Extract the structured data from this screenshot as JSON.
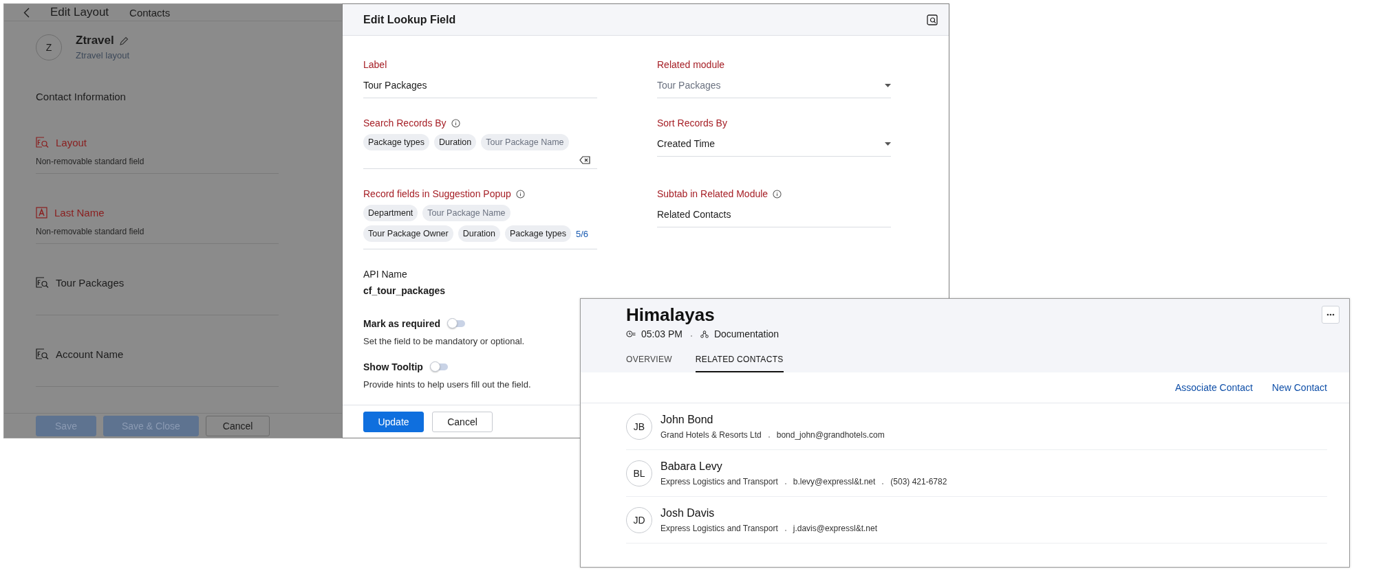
{
  "background_window": {
    "title": "Edit Layout",
    "breadcrumb": "Contacts",
    "layout": {
      "initial": "Z",
      "name": "Ztravel",
      "subtitle": "Ztravel layout"
    },
    "section_title": "Contact Information",
    "fields": [
      {
        "kind": "lookup",
        "label": "Layout",
        "standard": true,
        "note": "Non-removable standard field"
      },
      {
        "kind": "text",
        "label": "Last Name",
        "standard": true,
        "note": "Non-removable standard field"
      },
      {
        "kind": "lookup",
        "label": "Tour Packages",
        "standard": false
      },
      {
        "kind": "lookup",
        "label": "Account Name",
        "standard": false
      }
    ],
    "buttons": [
      {
        "label": "Save",
        "kind": "primary"
      },
      {
        "label": "Save & Close",
        "kind": "primary"
      },
      {
        "label": "Cancel",
        "kind": "secondary"
      }
    ]
  },
  "modal": {
    "title": "Edit Lookup Field",
    "label_field": {
      "label": "Label",
      "value": "Tour Packages"
    },
    "related_module": {
      "label": "Related module",
      "value": "Tour Packages",
      "disabled": true
    },
    "search_records_by": {
      "label": "Search Records By",
      "chips": [
        {
          "text": "Package types",
          "muted": false
        },
        {
          "text": "Duration",
          "muted": false
        },
        {
          "text": "Tour Package Name",
          "muted": true
        }
      ]
    },
    "sort_records_by": {
      "label": "Sort Records By",
      "value": "Created Time",
      "disabled": false
    },
    "suggestion_fields": {
      "label": "Record fields in Suggestion Popup",
      "count": "5/6",
      "chips": [
        {
          "text": "Department",
          "muted": false
        },
        {
          "text": "Tour Package Name",
          "muted": true
        },
        {
          "text": "Tour Package Owner",
          "muted": false
        },
        {
          "text": "Duration",
          "muted": false
        },
        {
          "text": "Package types",
          "muted": false
        }
      ]
    },
    "subtab": {
      "label": "Subtab in Related Module",
      "value": "Related Contacts"
    },
    "api_name": {
      "label": "API Name",
      "value": "cf_tour_packages"
    },
    "toggles": [
      {
        "label": "Mark as required",
        "on": false,
        "hint": "Set the field to be mandatory or optional."
      },
      {
        "label": "Show Tooltip",
        "on": false,
        "hint": "Provide hints to help users fill out the field."
      }
    ],
    "buttons": [
      {
        "label": "Update",
        "kind": "primary"
      },
      {
        "label": "Cancel",
        "kind": "secondary"
      }
    ]
  },
  "record_card": {
    "title": "Himalayas",
    "time": "05:03 PM",
    "category": "Documentation",
    "tabs": [
      {
        "label": "OVERVIEW",
        "selected": false
      },
      {
        "label": "RELATED CONTACTS",
        "selected": true
      }
    ],
    "actions": [
      "Associate Contact",
      "New Contact"
    ],
    "contacts": [
      {
        "initials": "JB",
        "name": "John Bond",
        "details": [
          "Grand Hotels & Resorts Ltd",
          "bond_john@grandhotels.com"
        ]
      },
      {
        "initials": "BL",
        "name": "Babara Levy",
        "details": [
          "Express Logistics and Transport",
          "b.levy@expressl&t.net",
          "(503) 421-6782"
        ]
      },
      {
        "initials": "JD",
        "name": "Josh Davis",
        "details": [
          "Express Logistics and Transport",
          "j.davis@expressl&t.net"
        ]
      }
    ]
  }
}
